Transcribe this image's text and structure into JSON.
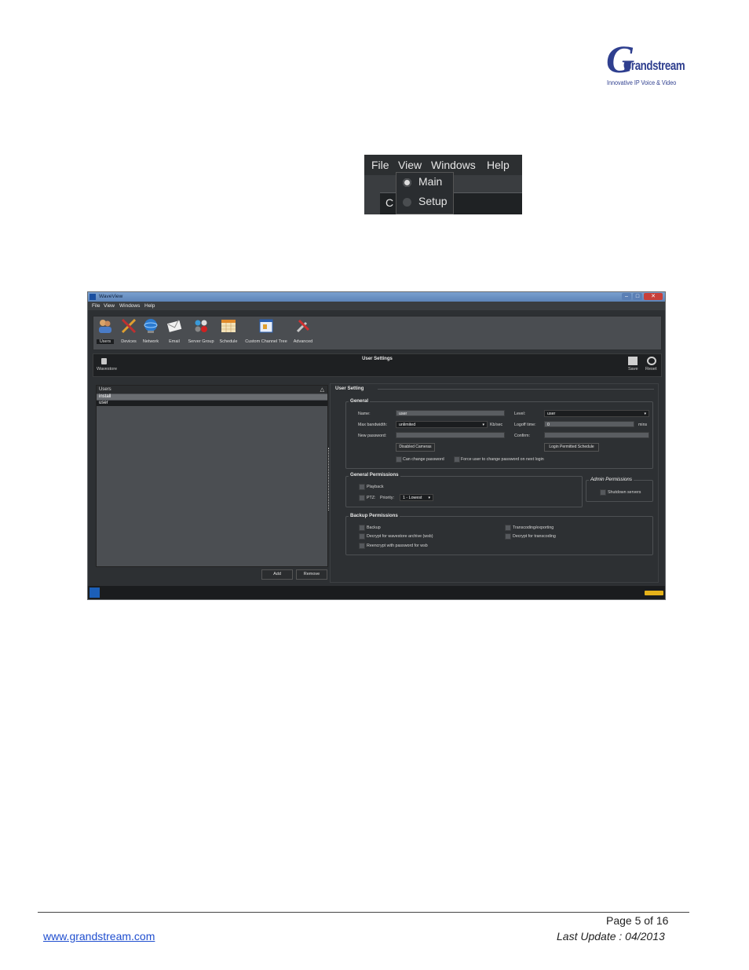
{
  "logo": {
    "brand": "Grandstream",
    "tagline": "Innovative IP Voice & Video"
  },
  "menu_snippet": {
    "items": [
      "File",
      "View",
      "Windows",
      "Help"
    ],
    "dropdown": [
      {
        "label": "Main",
        "selected": true
      },
      {
        "label": "Setup",
        "selected": false
      }
    ],
    "partial_label": "C"
  },
  "app": {
    "title": "WaveView",
    "menu": [
      "File",
      "View",
      "Windows",
      "Help"
    ],
    "toolbar": [
      {
        "label": "Users",
        "icon": "users-icon",
        "selected": true
      },
      {
        "label": "Devices",
        "icon": "devices-icon"
      },
      {
        "label": "Network",
        "icon": "network-icon"
      },
      {
        "label": "Email",
        "icon": "email-icon"
      },
      {
        "label": "Server Group",
        "icon": "server-group-icon"
      },
      {
        "label": "Schedule",
        "icon": "schedule-icon"
      },
      {
        "label": "Custom Channel Tree",
        "icon": "channel-tree-icon"
      },
      {
        "label": "Advanced",
        "icon": "advanced-icon"
      }
    ],
    "header": {
      "title": "User Settings",
      "left_label": "Wavestore",
      "save_label": "Save",
      "reset_label": "Reset"
    },
    "users_panel": {
      "column": "Users",
      "rows": [
        "install",
        "user"
      ],
      "add_label": "Add",
      "remove_label": "Remove"
    },
    "user_setting": {
      "title": "User Setting",
      "general": {
        "title": "General",
        "name_label": "Name:",
        "name_value": "user",
        "level_label": "Level:",
        "level_value": "user",
        "max_bw_label": "Max bandwidth:",
        "max_bw_value": "unlimited",
        "max_bw_unit": "Kb/sec",
        "logoff_label": "Logoff time:",
        "logoff_value": "0",
        "logoff_unit": "mins",
        "new_pw_label": "New password:",
        "confirm_label": "Confirm:",
        "disabled_cameras": "Disabled Cameras",
        "login_schedule": "Login Permitted Schedule",
        "can_change_pw": "Can change password",
        "force_change_pw": "Force user to change password on next login"
      },
      "general_permissions": {
        "title": "General Permissions",
        "playback": "Playback",
        "ptz": "PTZ:",
        "priority_label": "Priority:",
        "priority_value": "1 - Lowest"
      },
      "admin_permissions": {
        "title": "Admin Permissions",
        "shutdown": "Shutdown servers"
      },
      "backup_permissions": {
        "title": "Backup Permissions",
        "backup": "Backup",
        "decrypt_archive": "Decrypt for wavestore archive (wsb)",
        "reencrypt": "Reencrypt with password for wsb",
        "transcoding": "Transcoding/exporting",
        "decrypt_transcoding": "Decrypt for transcoding"
      }
    }
  },
  "footer": {
    "page": "Page 5 of 16",
    "website": "www.grandstream.com",
    "last_update": "Last Update : 04/2013"
  }
}
